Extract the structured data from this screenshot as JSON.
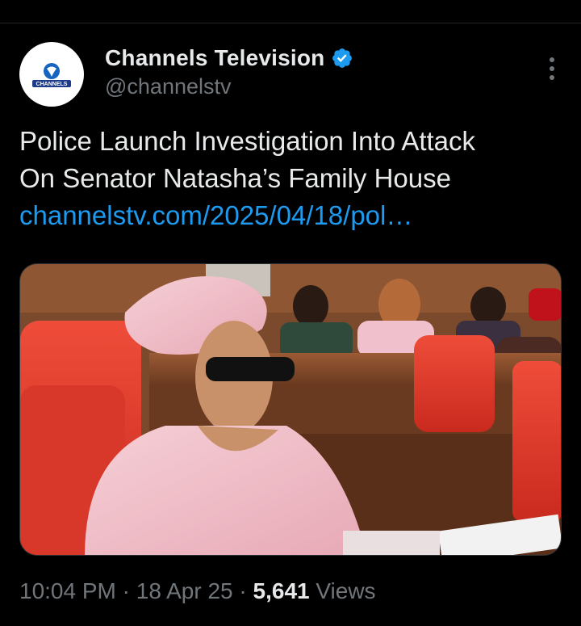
{
  "author": {
    "display_name": "Channels Television",
    "handle": "@channelstv",
    "avatar_text": "CHANNELS",
    "verified": true
  },
  "tweet": {
    "text_line1": "Police Launch Investigation Into Attack",
    "text_line2": "On Senator Natasha’s Family House",
    "link_text": "channelstv.com/2025/04/18/pol…"
  },
  "meta": {
    "time": "10:04 PM",
    "separator": "·",
    "date": "18 Apr 25",
    "views_count": "5,641",
    "views_label": "Views"
  },
  "colors": {
    "background": "#000000",
    "primary_text": "#e7e9ea",
    "secondary_text": "#71767b",
    "link": "#1d9bf0",
    "verified_badge": "#1d9bf0"
  },
  "icons": {
    "verified": "verified-badge-icon",
    "more": "more-vertical-icon"
  }
}
